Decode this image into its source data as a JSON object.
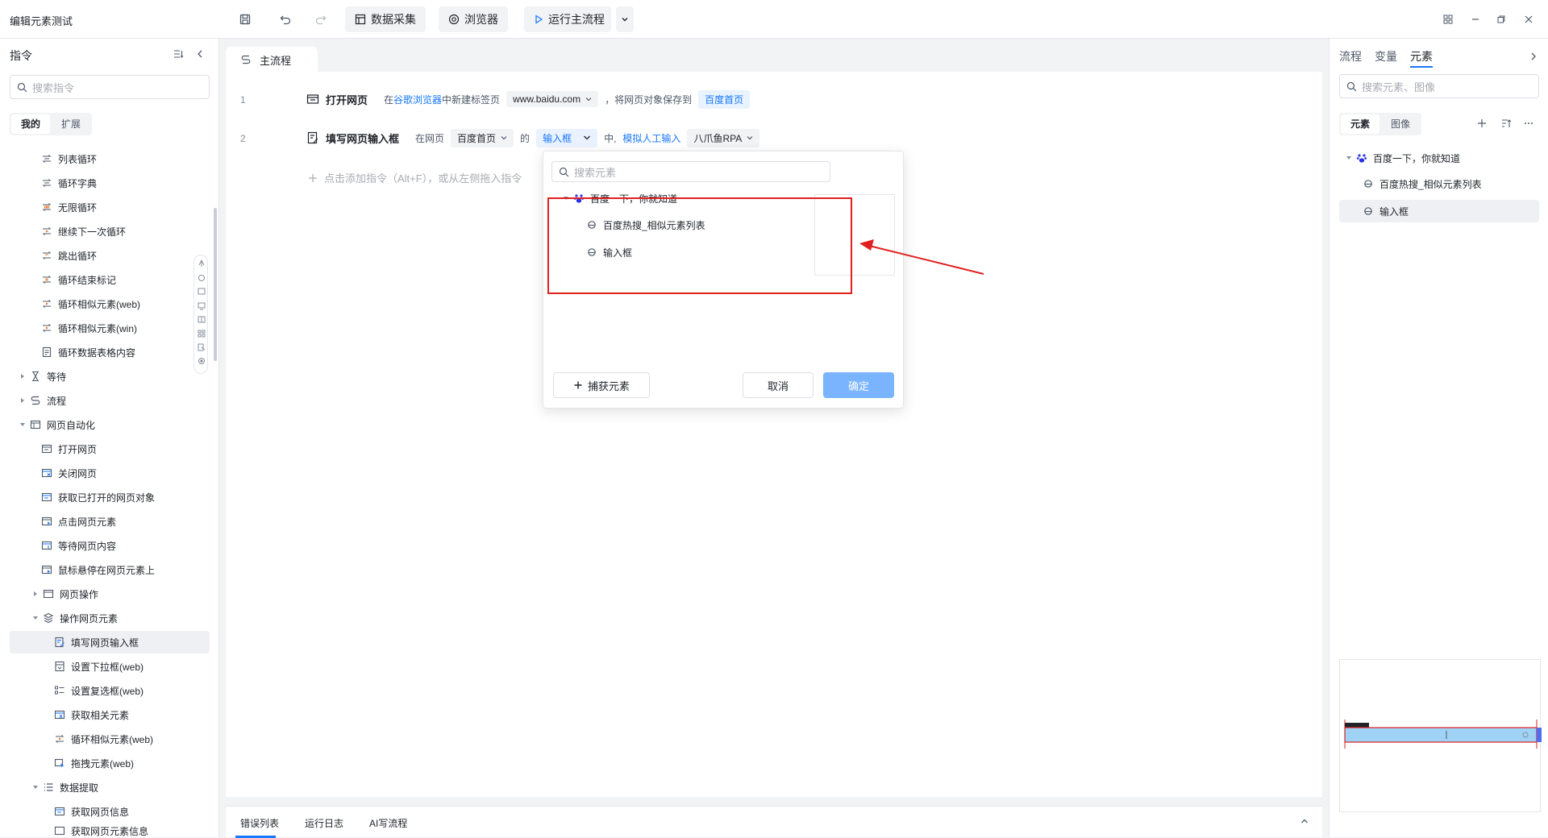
{
  "window": {
    "title": "编辑元素测试",
    "toolbar": {
      "data_collect": "数据采集",
      "browser": "浏览器",
      "run_main": "运行主流程"
    }
  },
  "left": {
    "title": "指令",
    "search_placeholder": "搜索指令",
    "tabs": [
      "我的",
      "扩展"
    ],
    "items": [
      {
        "label": "列表循环"
      },
      {
        "label": "循环字典"
      },
      {
        "label": "无限循环"
      },
      {
        "label": "继续下一次循环"
      },
      {
        "label": "跳出循环"
      },
      {
        "label": "循环结束标记"
      },
      {
        "label": "循环相似元素(web)"
      },
      {
        "label": "循环相似元素(win)"
      },
      {
        "label": "循环数据表格内容"
      },
      {
        "label": "等待"
      },
      {
        "label": "流程"
      },
      {
        "label": "网页自动化"
      },
      {
        "label": "打开网页"
      },
      {
        "label": "关闭网页"
      },
      {
        "label": "获取已打开的网页对象"
      },
      {
        "label": "点击网页元素"
      },
      {
        "label": "等待网页内容"
      },
      {
        "label": "鼠标悬停在网页元素上"
      },
      {
        "label": "网页操作"
      },
      {
        "label": "操作网页元素"
      },
      {
        "label": "填写网页输入框"
      },
      {
        "label": "设置下拉框(web)"
      },
      {
        "label": "设置复选框(web)"
      },
      {
        "label": "获取相关元素"
      },
      {
        "label": "循环相似元素(web)"
      },
      {
        "label": "拖拽元素(web)"
      },
      {
        "label": "数据提取"
      },
      {
        "label": "获取网页信息"
      },
      {
        "label": "获取网页元素信息"
      }
    ]
  },
  "center": {
    "tab": "主流程",
    "rows": [
      {
        "num": "1",
        "command": "打开网页",
        "t1": "在",
        "browser_link": "谷歌浏览器",
        "t2": "中新建标签页",
        "url": "www.baidu.com",
        "t3": "，将网页对象保存到",
        "var": "百度首页"
      },
      {
        "num": "2",
        "command": "填写网页输入框",
        "t1": "在网页",
        "page": "百度首页",
        "t2": "的",
        "element": "输入框",
        "t3": "中,",
        "mode": "模拟人工输入",
        "text": "八爪鱼RPA"
      }
    ],
    "add_hint": "点击添加指令（Alt+F），或从左侧拖入指令"
  },
  "popup": {
    "search_placeholder": "搜索元素",
    "root": "百度一下，你就知道",
    "children": [
      "百度热搜_相似元素列表",
      "输入框"
    ],
    "capture": "捕获元素",
    "cancel": "取消",
    "ok": "确定"
  },
  "bottom": {
    "tabs": [
      "错误列表",
      "运行日志",
      "AI写流程"
    ]
  },
  "right": {
    "tabs": [
      "流程",
      "变量",
      "元素"
    ],
    "search_placeholder": "搜索元素、图像",
    "subtabs": [
      "元素",
      "图像"
    ],
    "root": "百度一下，你就知道",
    "children": [
      "百度热搜_相似元素列表",
      "输入框"
    ]
  },
  "colors": {
    "accent": "#1677ff",
    "highlight_box": "#e02020"
  }
}
